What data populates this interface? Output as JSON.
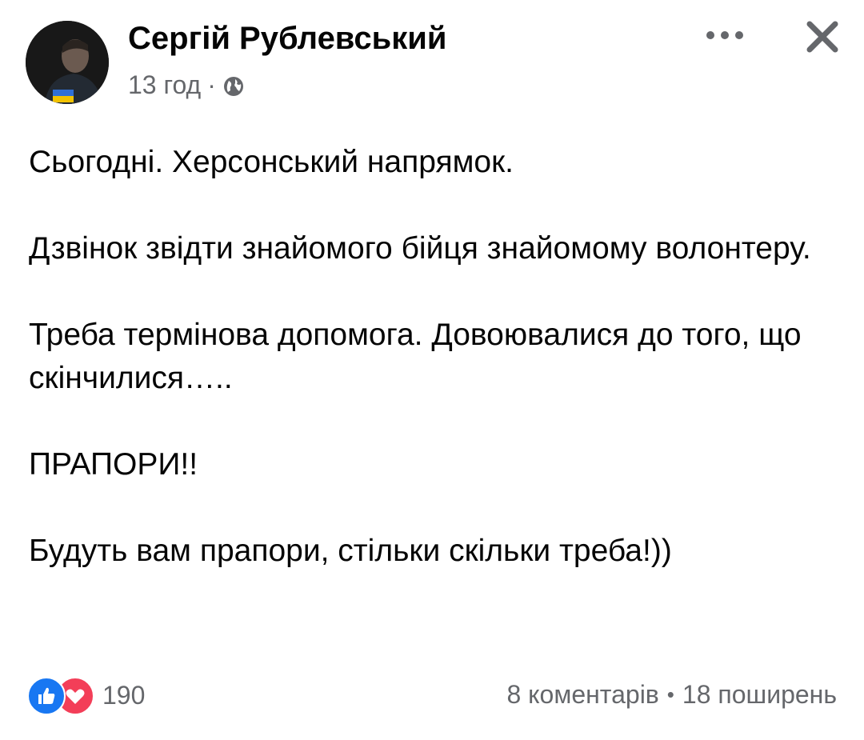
{
  "header": {
    "author_name": "Сергій Рублевський",
    "time": "13 год",
    "separator": "·",
    "audience_icon": "globe-icon",
    "more_icon": "more-dots-icon",
    "close_icon": "close-icon"
  },
  "post": {
    "paragraphs": [
      "Сьогодні. Херсонський напрямок.",
      "Дзвінок звідти знайомого бійця знайомому волонтеру.",
      "Треба термінова допомога. Довоювалися до того, що скінчилися…..",
      "ПРАПОРИ!!",
      "Будуть вам прапори, стільки скільки треба!))"
    ]
  },
  "footer": {
    "reaction_icons": [
      "like-icon",
      "love-icon"
    ],
    "reaction_count": "190",
    "comments": "8 коментарів",
    "stats_separator": "•",
    "shares": "18 поширень"
  },
  "colors": {
    "text": "#050505",
    "secondary_text": "#65676b",
    "like_blue": "#1877f2",
    "love_red": "#f33e58"
  }
}
